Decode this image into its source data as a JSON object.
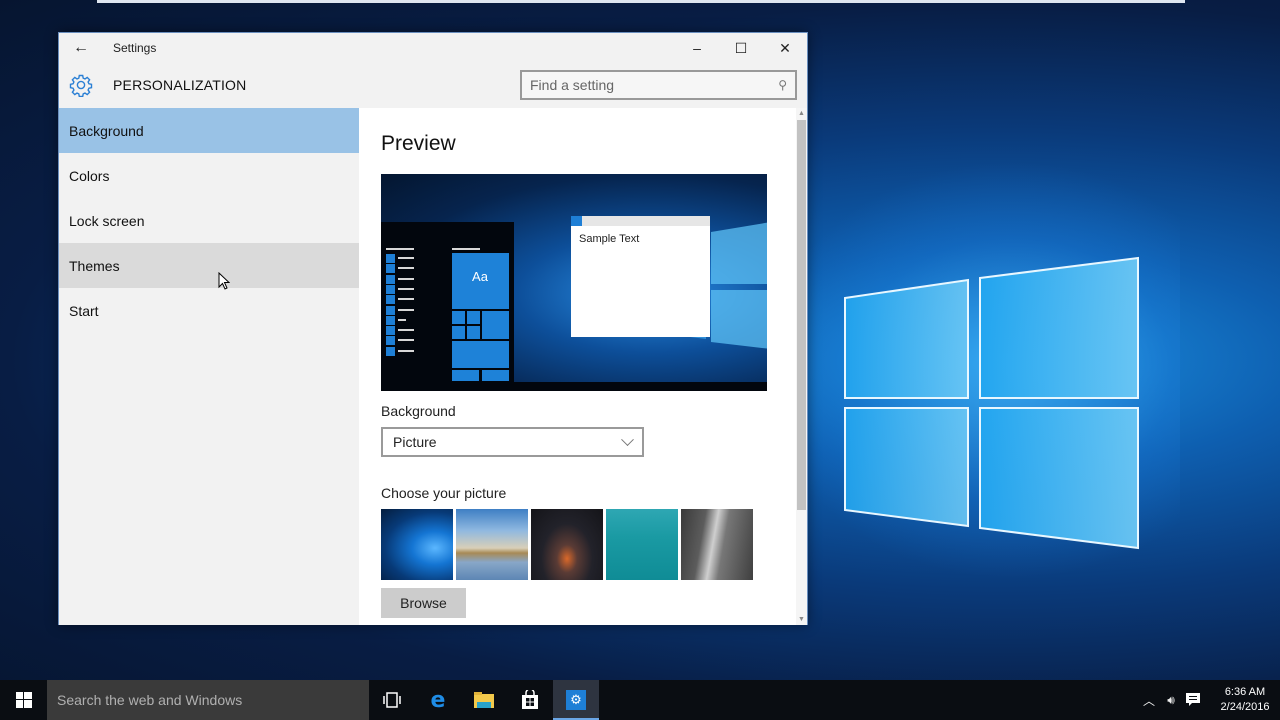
{
  "window": {
    "title": "Settings",
    "section_title": "PERSONALIZATION",
    "controls": {
      "minimize": "–",
      "maximize": "☐",
      "close": "✕"
    },
    "search": {
      "placeholder": "Find a setting",
      "value": ""
    }
  },
  "sidebar": {
    "items": [
      {
        "label": "Background",
        "state": "selected"
      },
      {
        "label": "Colors",
        "state": "normal"
      },
      {
        "label": "Lock screen",
        "state": "normal"
      },
      {
        "label": "Themes",
        "state": "hover"
      },
      {
        "label": "Start",
        "state": "normal"
      }
    ]
  },
  "content": {
    "heading": "Preview",
    "preview": {
      "tile_text": "Aa",
      "sample_text": "Sample Text"
    },
    "background_label": "Background",
    "background_select": {
      "selected": "Picture"
    },
    "choose_picture_label": "Choose your picture",
    "pictures": [
      {
        "name": "Windows 10 hero light"
      },
      {
        "name": "Beach with rock arches"
      },
      {
        "name": "Night sky with tent"
      },
      {
        "name": "Underwater swimmer"
      },
      {
        "name": "Rock waterfall black and white"
      }
    ],
    "browse_label": "Browse"
  },
  "taskbar": {
    "search_placeholder": "Search the web and Windows",
    "pinned": [
      {
        "name": "task-view",
        "active": false
      },
      {
        "name": "edge",
        "active": false
      },
      {
        "name": "file-explorer",
        "active": false
      },
      {
        "name": "store",
        "active": false
      },
      {
        "name": "settings",
        "active": true
      }
    ],
    "clock": {
      "time": "6:36 AM",
      "date": "2/24/2016"
    }
  },
  "colors": {
    "accent": "#1e7fd6",
    "selected_nav": "#99c2e6",
    "hover_nav": "#dadada"
  }
}
